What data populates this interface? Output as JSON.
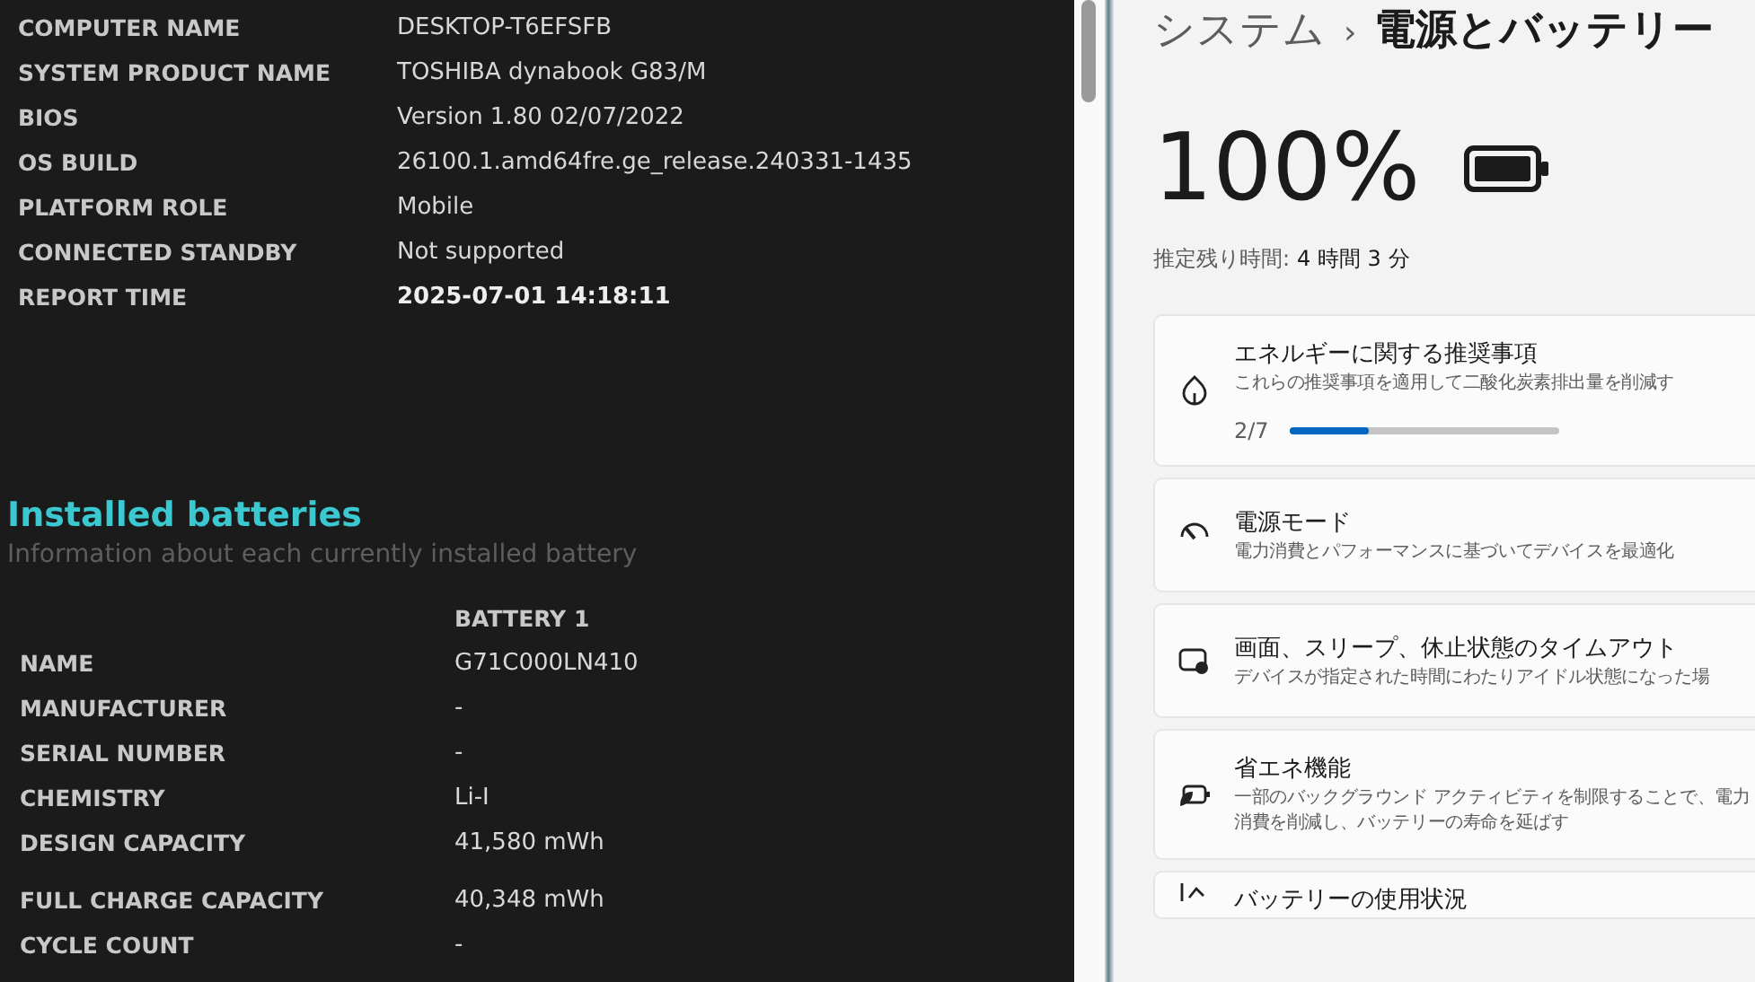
{
  "report": {
    "system_rows": [
      {
        "label": "COMPUTER NAME",
        "value": "DESKTOP-T6EFSFB",
        "strong": false
      },
      {
        "label": "SYSTEM PRODUCT NAME",
        "value": "TOSHIBA dynabook G83/M",
        "strong": false
      },
      {
        "label": "BIOS",
        "value": "Version 1.80 02/07/2022",
        "strong": false
      },
      {
        "label": "OS BUILD",
        "value": "26100.1.amd64fre.ge_release.240331-1435",
        "strong": false
      },
      {
        "label": "PLATFORM ROLE",
        "value": "Mobile",
        "strong": false
      },
      {
        "label": "CONNECTED STANDBY",
        "value": "Not supported",
        "strong": false
      },
      {
        "label": "REPORT TIME",
        "value": "2025-07-01  14:18:11",
        "strong": true
      }
    ],
    "section_title": "Installed batteries",
    "section_subtitle": "Information about each currently installed battery",
    "battery_header": "BATTERY 1",
    "battery_rows": [
      {
        "label": "NAME",
        "value": "G71C000LN410"
      },
      {
        "label": "MANUFACTURER",
        "value": "-"
      },
      {
        "label": "SERIAL NUMBER",
        "value": "-"
      },
      {
        "label": "CHEMISTRY",
        "value": "Li-I"
      },
      {
        "label": "DESIGN CAPACITY",
        "value": "41,580 mWh"
      },
      {
        "label": "FULL CHARGE CAPACITY",
        "value": "40,348 mWh"
      },
      {
        "label": "CYCLE COUNT",
        "value": "-"
      }
    ]
  },
  "settings": {
    "breadcrumb": [
      "システム",
      "›",
      "電源とバッテリー"
    ],
    "percent": "100%",
    "remaining_label": "推定残り時間:",
    "remaining_value": "4 時間 3 分",
    "cards": [
      {
        "kind": "leaf",
        "title": "エネルギーに関する推奨事項",
        "description": "これらの推奨事項を適用して二酸化炭素排出量を削減す",
        "progress_text": "2/7",
        "level": 0.29
      },
      {
        "kind": "gauge",
        "title": "電源モード",
        "description": "電力消費とパフォーマンスに基づいてデバイスを最適化"
      },
      {
        "kind": "screen",
        "title": "画面、スリープ、休止状態のタイムアウト",
        "description": "デバイスが指定された時間にわたりアイドル状態になった場"
      },
      {
        "kind": "saver",
        "title": "省エネ機能",
        "description": "一部のバックグラウンド アクティビティを制限することで、電力消費を削減し、バッテリーの寿命を延ばす"
      },
      {
        "kind": "chart",
        "title": "バッテリーの使用状況"
      }
    ]
  }
}
